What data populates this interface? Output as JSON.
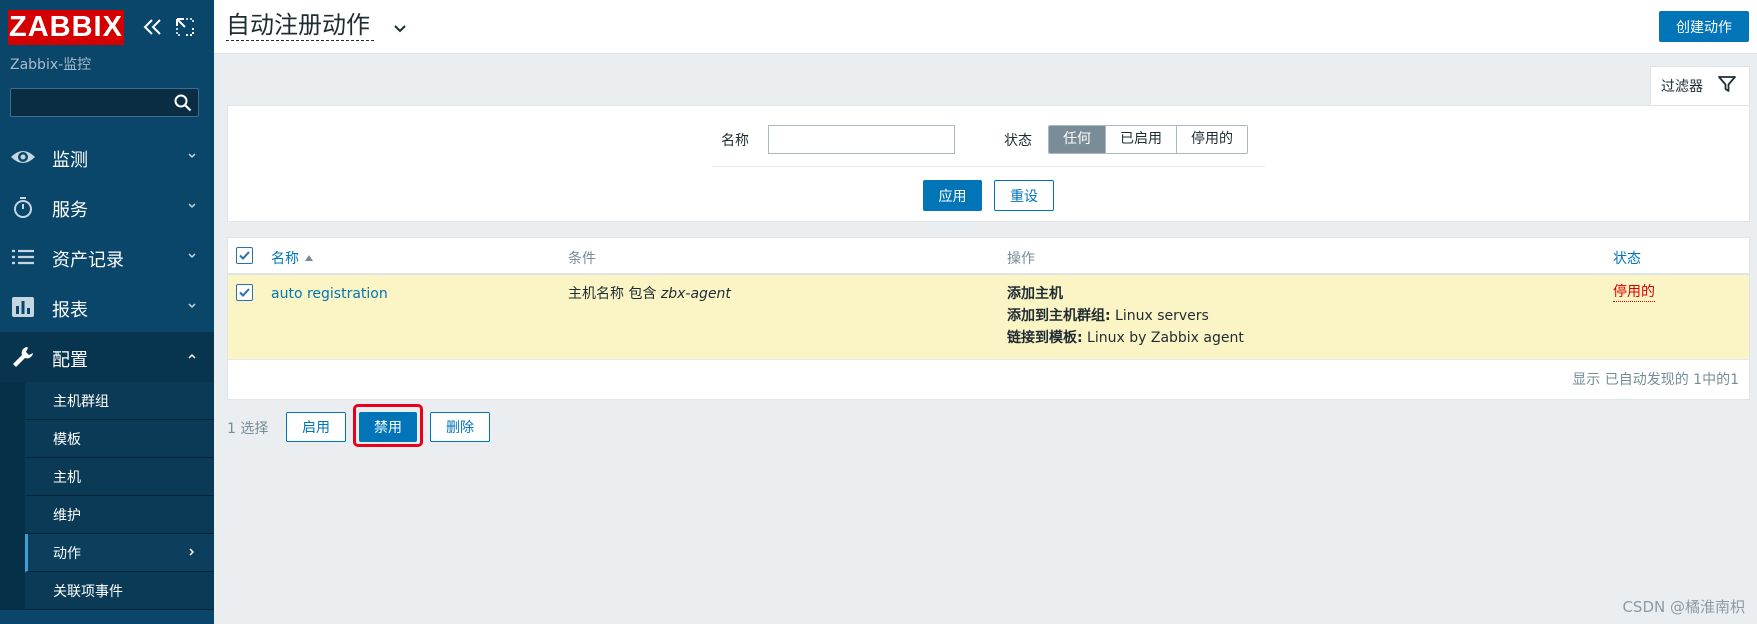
{
  "sidebar": {
    "logo": "ZABBIX",
    "server_name": "Zabbix-监控",
    "search_placeholder": "",
    "menu": [
      {
        "label": "监测",
        "icon": "eye-icon"
      },
      {
        "label": "服务",
        "icon": "stopwatch-icon"
      },
      {
        "label": "资产记录",
        "icon": "list-icon"
      },
      {
        "label": "报表",
        "icon": "bar-chart-icon"
      },
      {
        "label": "配置",
        "icon": "wrench-icon"
      }
    ],
    "submenu": [
      {
        "label": "主机群组"
      },
      {
        "label": "模板"
      },
      {
        "label": "主机"
      },
      {
        "label": "维护"
      },
      {
        "label": "动作"
      },
      {
        "label": "关联项事件"
      }
    ]
  },
  "header": {
    "title": "自动注册动作",
    "create_button": "创建动作"
  },
  "filter": {
    "tab_label": "过滤器",
    "name_label": "名称",
    "name_value": "",
    "status_label": "状态",
    "status_options": [
      "任何",
      "已启用",
      "停用的"
    ],
    "status_selected": "任何",
    "apply": "应用",
    "reset": "重设"
  },
  "table": {
    "columns": {
      "name": "名称",
      "conditions": "条件",
      "operations": "操作",
      "status": "状态"
    },
    "rows": [
      {
        "name": "auto registration",
        "condition_prefix": "主机名称 包含 ",
        "condition_value": "zbx-agent",
        "op1_label": "添加主机",
        "op2_label": "添加到主机群组:",
        "op2_value": " Linux servers",
        "op3_label": "链接到模板:",
        "op3_value": " Linux by Zabbix agent",
        "status": "停用的"
      }
    ],
    "footer": "显示 已自动发现的 1中的1"
  },
  "actions": {
    "selected_count": "1 选择",
    "enable": "启用",
    "disable": "禁用",
    "delete": "删除"
  },
  "watermark": "CSDN @橘淮南枳",
  "colors": {
    "sidebar_bg": "#0a466a",
    "accent": "#0275b8",
    "logo_red": "#d40000",
    "highlight_row": "#fbf4c4",
    "disabled_red": "#dc0000"
  }
}
